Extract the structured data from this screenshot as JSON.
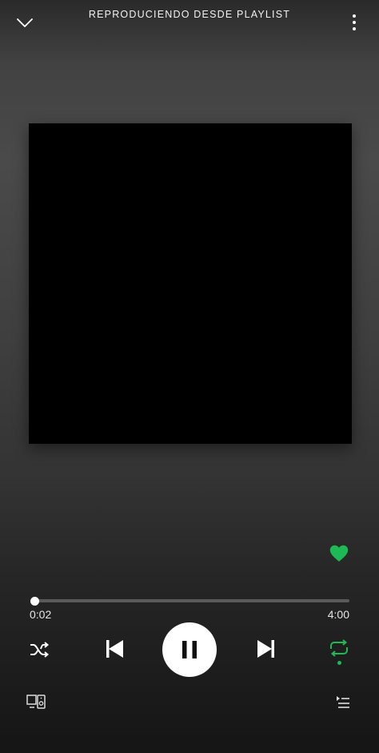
{
  "header": {
    "title": "REPRODUCIENDO DESDE PLAYLIST",
    "collapse_icon": "chevron-down-icon",
    "more_icon": "more-vertical-icon"
  },
  "track": {
    "title": "",
    "artist": "",
    "liked": true
  },
  "progress": {
    "elapsed": "0:02",
    "total": "4:00",
    "fraction": 0.008
  },
  "controls": {
    "shuffle_icon": "shuffle-icon",
    "previous_icon": "skip-previous-icon",
    "play_pause_icon": "pause-icon",
    "next_icon": "skip-next-icon",
    "repeat_icon": "repeat-icon",
    "repeat_active": true
  },
  "bottom": {
    "devices_icon": "devices-icon",
    "queue_icon": "queue-icon"
  },
  "colors": {
    "accent": "#1db954",
    "artwork": "#000000",
    "text": "#ffffff"
  }
}
